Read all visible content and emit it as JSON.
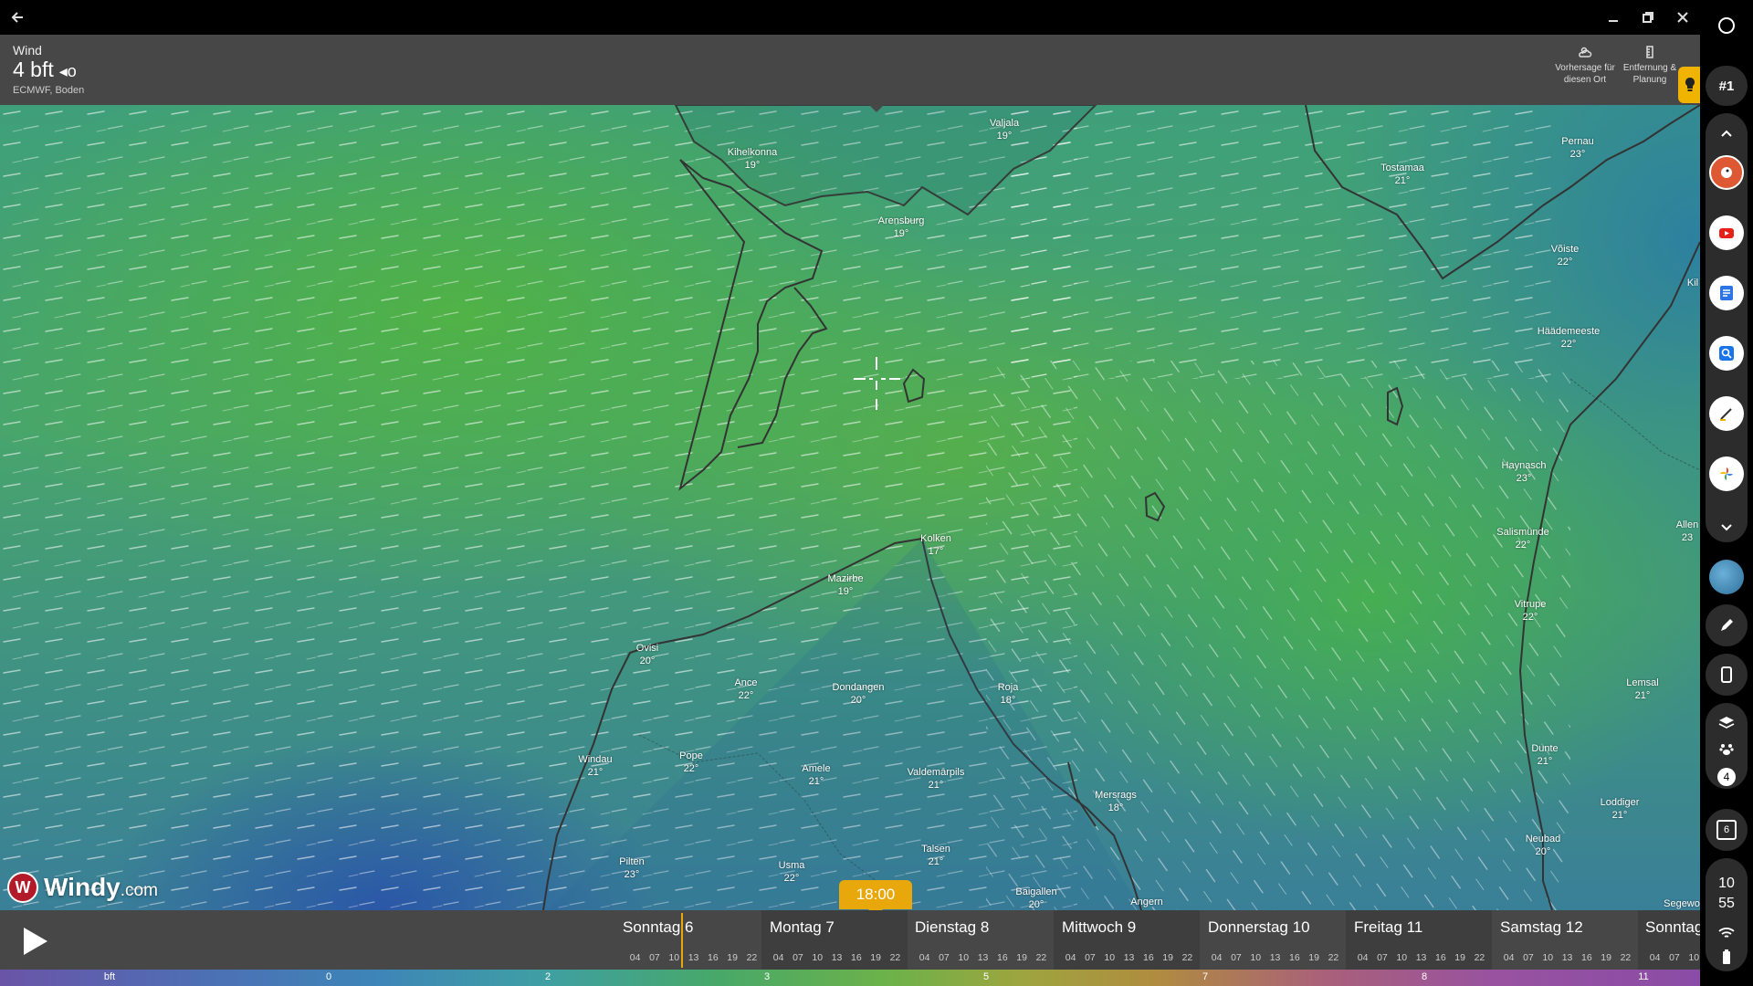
{
  "window": {
    "back_icon": "arrow-left-icon",
    "minimize_icon": "minimize-icon",
    "restore_icon": "restore-icon",
    "close_icon": "close-icon"
  },
  "info": {
    "layer_name": "Wind",
    "value": "4 bft",
    "direction_glyph": "◂o",
    "source": "ECMWF, Boden",
    "forecast_label_1": "Vorhersage für",
    "forecast_label_2": "diesen Ort",
    "distance_label_1": "Entfernung &",
    "distance_label_2": "Planung"
  },
  "cities": [
    {
      "name": "Valjala",
      "temp": "19°"
    },
    {
      "name": "Kihelkonna",
      "temp": "19°"
    },
    {
      "name": "Arensburg",
      "temp": "19°"
    },
    {
      "name": "Pernau",
      "temp": "23°"
    },
    {
      "name": "Tostamaa",
      "temp": "21°"
    },
    {
      "name": "Võiste",
      "temp": "22°"
    },
    {
      "name": "Häädemeeste",
      "temp": "22°"
    },
    {
      "name": "Haynasch",
      "temp": "23°"
    },
    {
      "name": "Salismünde",
      "temp": "22°"
    },
    {
      "name": "Vitrupe",
      "temp": "22°"
    },
    {
      "name": "Kolken",
      "temp": "17°"
    },
    {
      "name": "Mazirbe",
      "temp": "19°"
    },
    {
      "name": "Ovisi",
      "temp": "20°"
    },
    {
      "name": "Ance",
      "temp": "22°"
    },
    {
      "name": "Dondangen",
      "temp": "20°"
    },
    {
      "name": "Roja",
      "temp": "18°"
    },
    {
      "name": "Windau",
      "temp": "21°"
    },
    {
      "name": "Pope",
      "temp": "22°"
    },
    {
      "name": "Amele",
      "temp": "21°"
    },
    {
      "name": "Valdemārpils",
      "temp": "21°"
    },
    {
      "name": "Mersrags",
      "temp": "18°"
    },
    {
      "name": "Lemsal",
      "temp": "21°"
    },
    {
      "name": "Dunte",
      "temp": "21°"
    },
    {
      "name": "Loddiger",
      "temp": "21°"
    },
    {
      "name": "Neubad",
      "temp": "20°"
    },
    {
      "name": "Pilten",
      "temp": "23°"
    },
    {
      "name": "Usma",
      "temp": "22°"
    },
    {
      "name": "Talsen",
      "temp": "21°"
    },
    {
      "name": "Baigallen",
      "temp": "20°"
    },
    {
      "name": "Angern",
      "temp": ""
    },
    {
      "name": "Segewo",
      "temp": ""
    },
    {
      "name": "Allen",
      "temp": "23"
    },
    {
      "name": "Kil",
      "temp": ""
    }
  ],
  "brand": {
    "name": "Windy",
    "suffix": ".com"
  },
  "timeline": {
    "current_time": "18:00",
    "play_icon": "play-icon",
    "hours": [
      "04",
      "07",
      "10",
      "13",
      "16",
      "19",
      "22"
    ],
    "days": [
      {
        "name": "Sonntag 6"
      },
      {
        "name": "Montag 7"
      },
      {
        "name": "Dienstag 8"
      },
      {
        "name": "Mittwoch 9"
      },
      {
        "name": "Donnerstag 10"
      },
      {
        "name": "Freitag 11"
      },
      {
        "name": "Samstag 12"
      },
      {
        "name": "Sonntag"
      }
    ]
  },
  "legend": {
    "unit": "bft",
    "ticks": [
      "0",
      "2",
      "3",
      "5",
      "7",
      "8",
      "11"
    ]
  },
  "sidebar": {
    "home_icon": "circle-home-icon",
    "badge": "#1",
    "up_icon": "chevron-up-icon",
    "apps": [
      "duckduckgo-icon",
      "youtube-icon",
      "docs-icon",
      "search-app-icon",
      "notes-icon",
      "photos-icon"
    ],
    "down_icon": "chevron-down-icon",
    "globe_icon": "globe-icon",
    "pen_icon": "pen-icon",
    "phone_icon": "phone-icon",
    "layers_icon": "layers-icon",
    "paw_icon": "paw-icon",
    "count": "4",
    "calendar_day": "6",
    "clock_hour": "10",
    "clock_minute": "55",
    "wifi_icon": "wifi-icon",
    "battery_icon": "battery-icon"
  }
}
